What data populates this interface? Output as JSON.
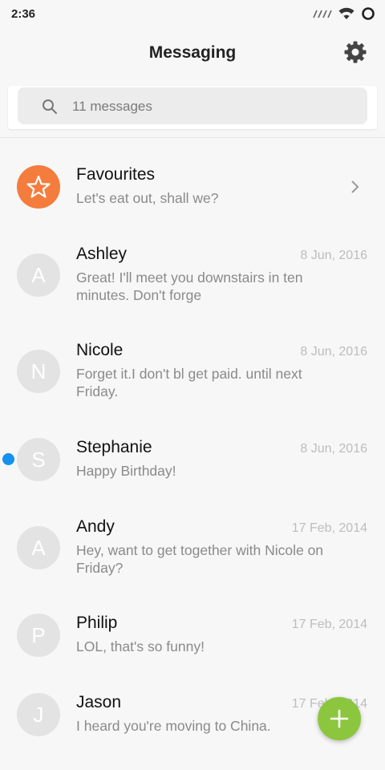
{
  "status_bar": {
    "time": "2:36"
  },
  "header": {
    "title": "Messaging"
  },
  "search": {
    "placeholder": "11 messages"
  },
  "colors": {
    "favourites_accent": "#f47c3c",
    "unread_dot": "#1591ee",
    "fab": "#8cc63f"
  },
  "favourites": {
    "name": "Favourites",
    "snippet": "Let's eat out, shall we?",
    "icon": "star-icon"
  },
  "conversations": [
    {
      "initial": "A",
      "name": "Ashley",
      "date": "8 Jun, 2016",
      "snippet": "Great! I'll meet you downstairs in ten minutes. Don't forge",
      "unread": false
    },
    {
      "initial": "N",
      "name": "Nicole",
      "date": "8 Jun, 2016",
      "snippet": "Forget it.I don't bl get paid. until next Friday.",
      "unread": false
    },
    {
      "initial": "S",
      "name": "Stephanie",
      "date": "8 Jun, 2016",
      "snippet": "Happy Birthday!",
      "unread": true
    },
    {
      "initial": "A",
      "name": "Andy",
      "date": "17 Feb, 2014",
      "snippet": "Hey, want to get together with Nicole on Friday?",
      "unread": false
    },
    {
      "initial": "P",
      "name": "Philip",
      "date": "17 Feb, 2014",
      "snippet": "LOL, that's so funny!",
      "unread": false
    },
    {
      "initial": "J",
      "name": "Jason",
      "date": "17 Feb, 2014",
      "snippet": "I heard you're moving to China.",
      "unread": false
    }
  ],
  "fab": {
    "icon": "plus-icon"
  }
}
